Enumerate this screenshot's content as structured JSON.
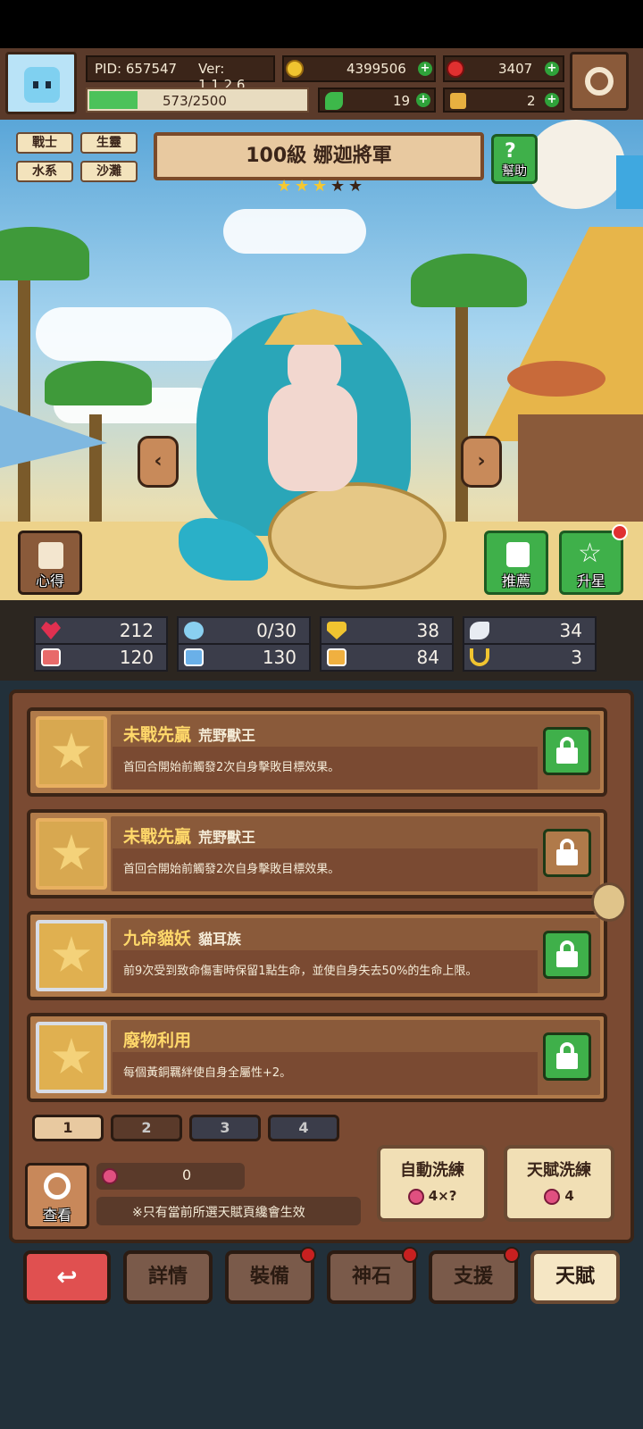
{
  "header": {
    "pid": "PID: 657547",
    "version": "Ver: 1.1.2.6",
    "exp": "573/2500",
    "exp_progress": 0.229,
    "gold": "4399506",
    "gems": "3407",
    "clover": "19",
    "hand": "2"
  },
  "tags": [
    "戰士",
    "生靈",
    "水系",
    "沙灘"
  ],
  "hero": {
    "title": "100級  娜迦將軍",
    "stars_filled": 3,
    "stars_total": 5,
    "help_label": "幫助",
    "notes_label": "心得",
    "recommend_label": "推薦",
    "upstar_label": "升星"
  },
  "stats": {
    "hp": "212",
    "mana": "0/30",
    "def": "38",
    "wing": "34",
    "atk": "120",
    "book": "130",
    "agi": "84",
    "luck": "3"
  },
  "talents": [
    {
      "name": "未戰先贏",
      "sub": "荒野獸王",
      "desc": "首回合開始前觸發2次自身擊敗目標效果。",
      "locked_color": "green"
    },
    {
      "name": "未戰先贏",
      "sub": "荒野獸王",
      "desc": "首回合開始前觸發2次自身擊敗目標效果。",
      "locked_color": "brown"
    },
    {
      "name": "九命貓妖",
      "sub": "貓耳族",
      "desc": "前9次受到致命傷害時保留1點生命，並使自身失去50%的生命上限。",
      "locked_color": "green"
    },
    {
      "name": "廢物利用",
      "sub": "",
      "desc": "每個黃銅羈絆使自身全屬性+2。",
      "locked_color": "green"
    }
  ],
  "pages": [
    "1",
    "2",
    "3",
    "4"
  ],
  "bottom": {
    "view_label": "查看",
    "potion_count": "0",
    "note": "※只有當前所選天賦頁纔會生效",
    "auto_reroll_label": "自動洗練",
    "auto_reroll_cost": "4×?",
    "talent_reroll_label": "天賦洗練",
    "talent_reroll_cost": "4"
  },
  "nav": {
    "details": "詳情",
    "equip": "裝備",
    "stone": "神石",
    "support": "支援",
    "talent": "天賦"
  }
}
